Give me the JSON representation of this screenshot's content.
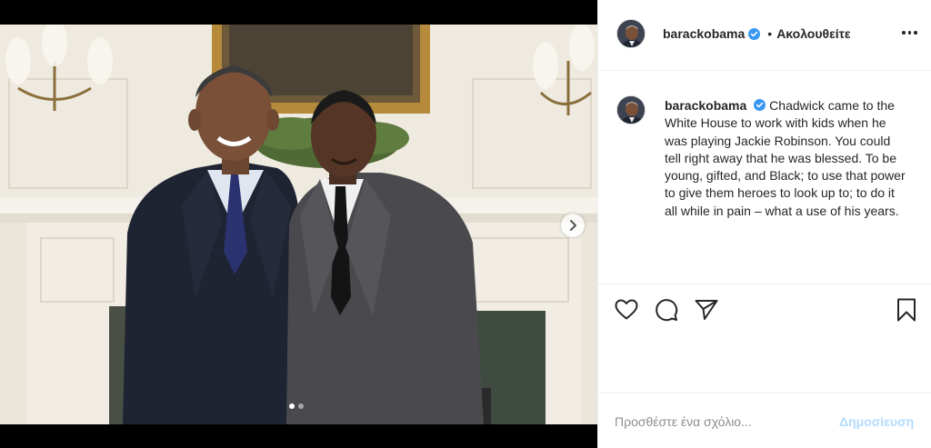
{
  "post": {
    "photo_alt": "Two men in dark suits standing in a room with a fireplace and framed painting",
    "carousel": {
      "total_slides": 2,
      "active_slide": 1
    }
  },
  "author": {
    "username": "barackobama",
    "verified": true,
    "follow_status": "Ακολουθείτε",
    "separator": "•"
  },
  "caption": {
    "username": "barackobama",
    "text": "Chadwick came to the White House to work with kids when he was playing Jackie Robinson. You could tell right away that he was blessed. To be young, gifted, and Black; to use that power to give them heroes to look up to; to do it all while in pain – what a use of his years."
  },
  "actions": {
    "like": "heart-icon",
    "comment": "comment-bubble-icon",
    "share": "paper-plane-icon",
    "save": "bookmark-icon"
  },
  "comment_box": {
    "placeholder": "Προσθέστε ένα σχόλιο...",
    "post_label": "Δημοσίευση"
  },
  "colors": {
    "verified_blue": "#3897f0",
    "post_button_disabled": "#b3dbff",
    "border": "#efefef"
  }
}
